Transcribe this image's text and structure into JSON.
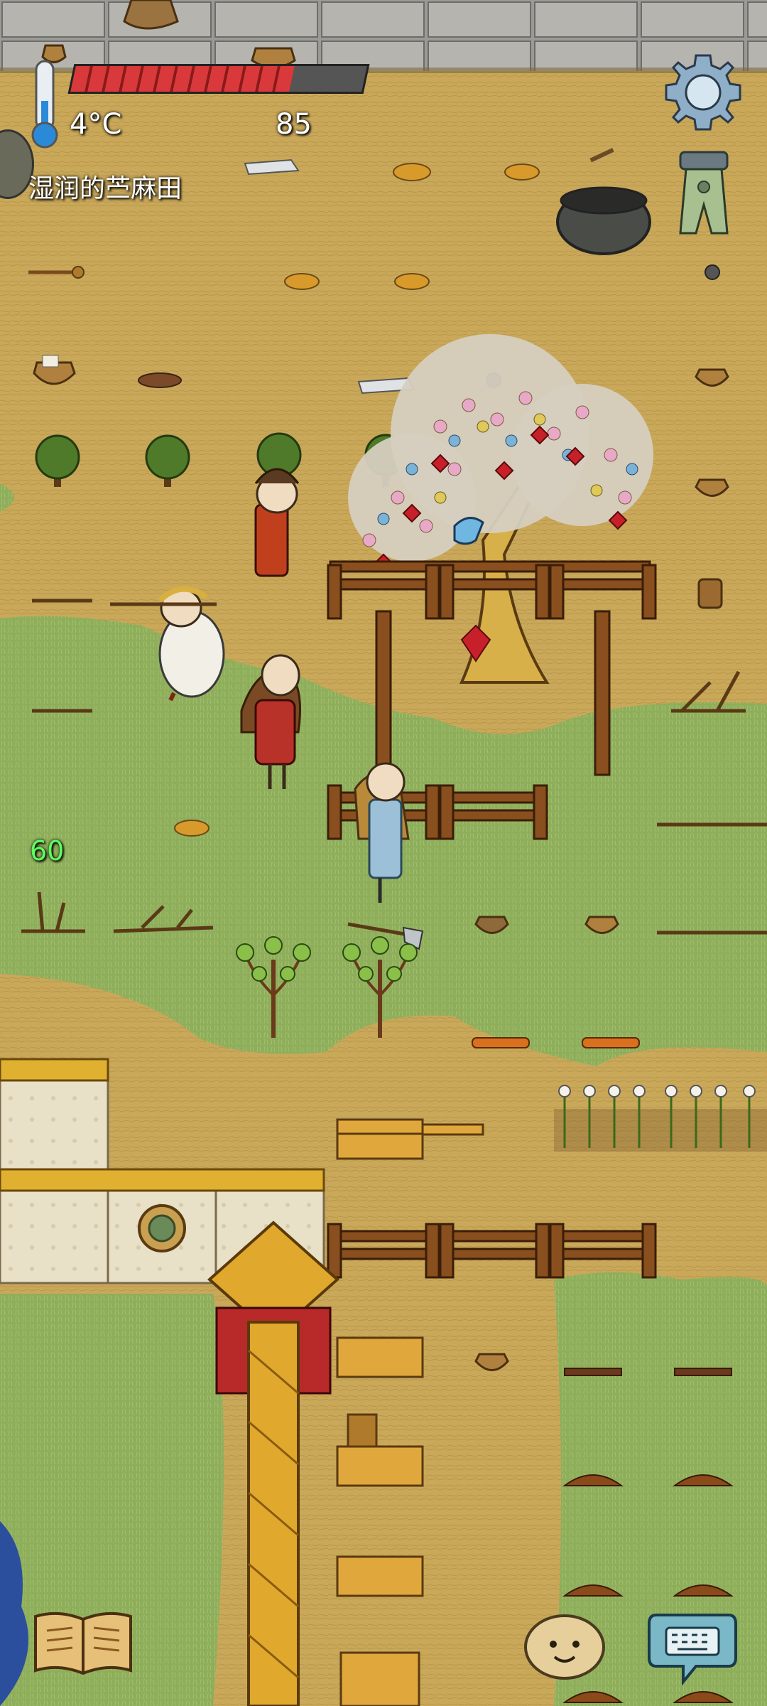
{
  "hud": {
    "temperature": "4°C",
    "food_count": "85",
    "location": "湿润的苎麻田",
    "side_number": "60",
    "health_fraction": 0.75
  },
  "icons": {
    "thermometer": "thermometer-icon",
    "settings": "gear-icon",
    "scale": "scale-icon",
    "book": "book-icon",
    "emote": "emote-face-icon",
    "keyboard": "keyboard-icon"
  },
  "colors": {
    "ground": "#c9a85a",
    "grass": "#8cab5a",
    "health_bar": "#d9393a",
    "side_number": "#5dff5d"
  }
}
